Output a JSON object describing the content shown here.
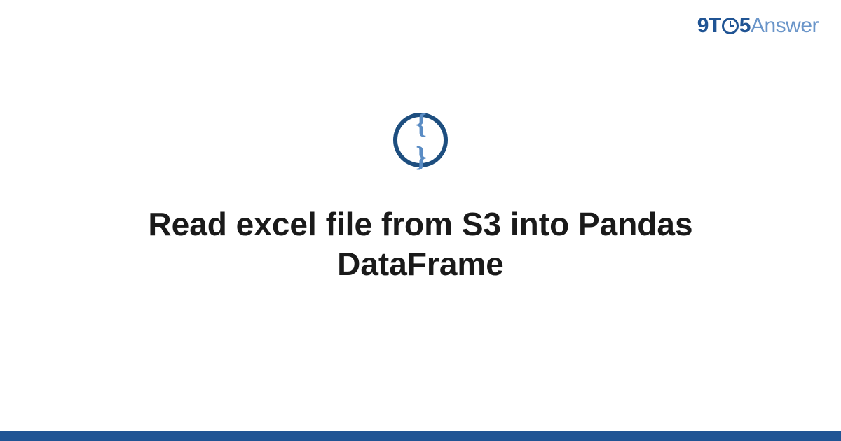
{
  "logo": {
    "prefix_9": "9",
    "prefix_t": "T",
    "suffix_5": "5",
    "answer": "Answer"
  },
  "icon": {
    "braces": "{ }"
  },
  "title": "Read excel file from S3 into Pandas DataFrame"
}
